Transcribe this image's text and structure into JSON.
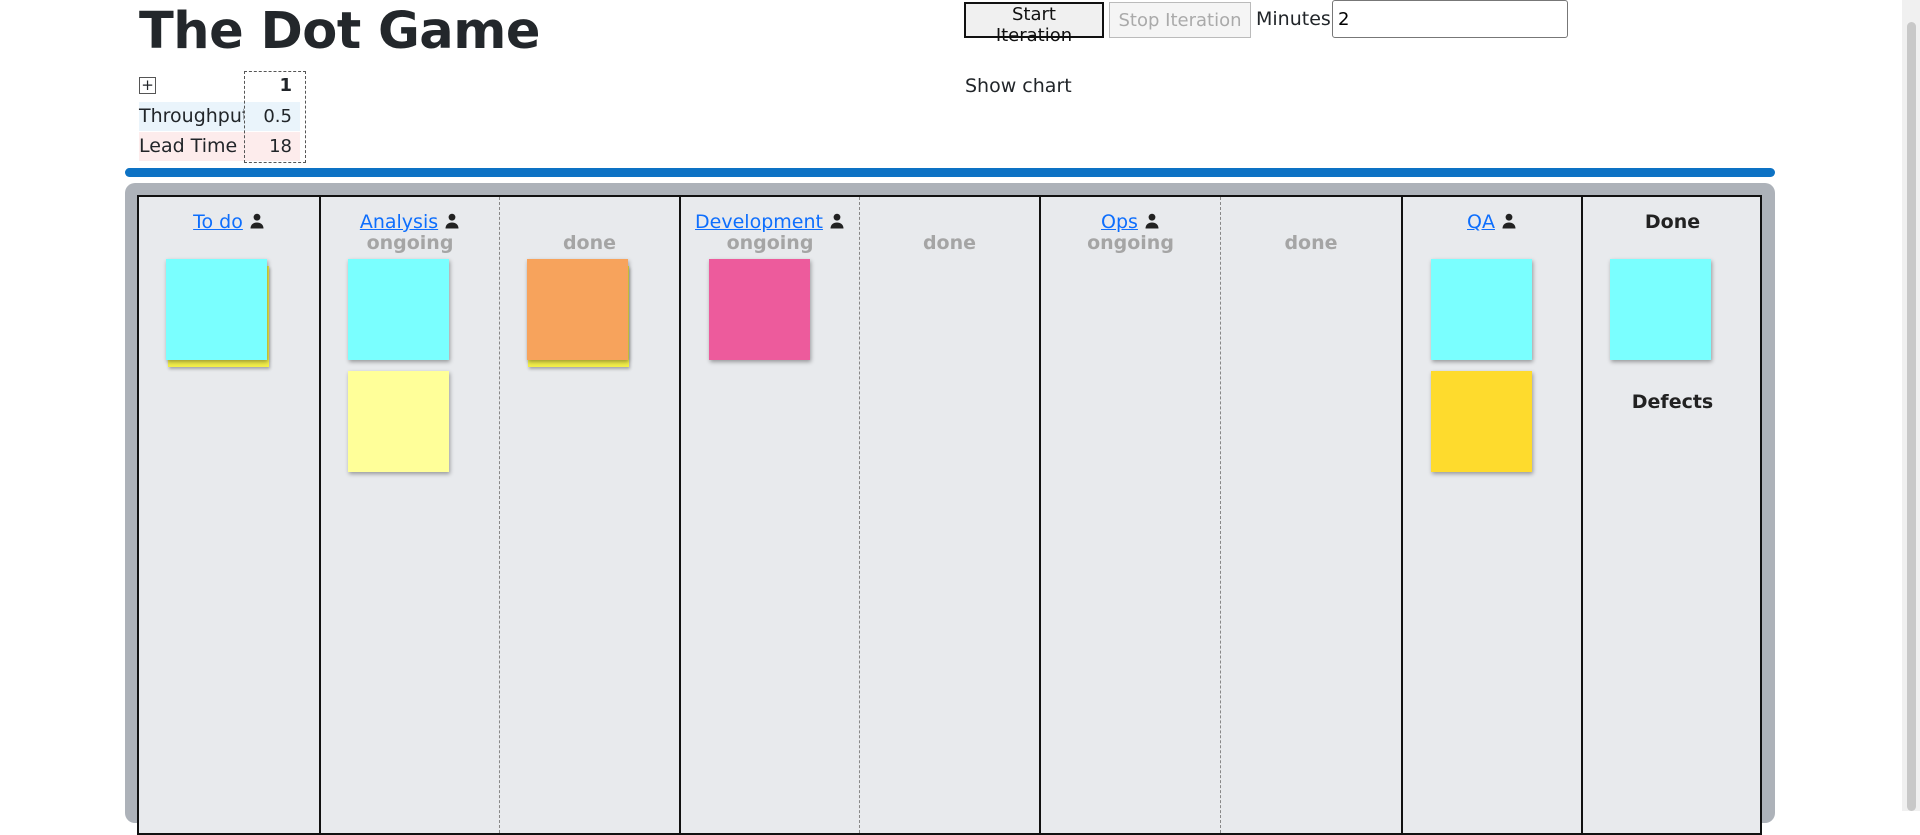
{
  "title": "The Dot Game",
  "stats": {
    "toggle": "+",
    "iteration": "1",
    "throughput_label": "Throughput",
    "throughput_value": "0.5",
    "lead_time_label": "Lead Time",
    "lead_time_value": "18"
  },
  "controls": {
    "start": "Start Iteration",
    "stop": "Stop Iteration",
    "minutes_label": "Minutes",
    "minutes_value": "2"
  },
  "show_chart": "Show chart",
  "board": {
    "todo": "To do",
    "analysis": "Analysis",
    "development": "Development",
    "ops": "Ops",
    "qa": "QA",
    "ongoing": "ongoing",
    "done": "done",
    "done_column": "Done",
    "defects": "Defects"
  },
  "colors": {
    "cyan": "#7affff",
    "light_yellow": "#ffff99",
    "orange": "#f7a35c",
    "pink": "#ed5b9c",
    "yellow": "#fedb2d",
    "accent": "#0d72c4"
  }
}
